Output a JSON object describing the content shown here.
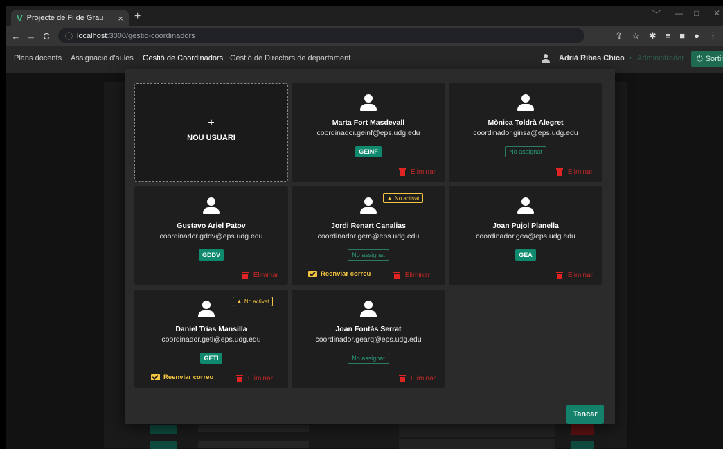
{
  "browser": {
    "tab_title": "Projecte de Fi de Grau",
    "tab_close": "×",
    "new_tab": "+",
    "url_host": "localhost",
    "url_path": ":3000/gestio-coordinadors"
  },
  "nav": {
    "links": [
      "Plans docents",
      "Assignació d'aules",
      "Gestió de Coordinadors",
      "Gestió de Directors de departament"
    ],
    "active_index": 2,
    "user_name": "Adrià Ribas Chico",
    "role": "Administrador",
    "logout_label": "Sortir"
  },
  "modal": {
    "new_user_plus": "+",
    "new_user_label": "NOU USUARI",
    "close_label": "Tancar",
    "delete_label": "Eliminar",
    "resend_label": "Reenviar correu",
    "not_activated_label": "No activat",
    "coordinators": [
      {
        "name": "Marta Fort Masdevall",
        "email": "coordinador.geinf@eps.udg.edu",
        "badge": "GEINF",
        "assigned": true,
        "activated": true
      },
      {
        "name": "Mònica Toldrà Alegret",
        "email": "coordinador.ginsa@eps.udg.edu",
        "badge": "No assignat",
        "assigned": false,
        "activated": true
      },
      {
        "name": "Gustavo Ariel Patov",
        "email": "coordinador.gddv@eps.udg.edu",
        "badge": "GDDV",
        "assigned": true,
        "activated": true
      },
      {
        "name": "Jordi Renart Canalias",
        "email": "coordinador.gem@eps.udg.edu",
        "badge": "No assignat",
        "assigned": false,
        "activated": false
      },
      {
        "name": "Joan Pujol Planella",
        "email": "coordinador.gea@eps.udg.edu",
        "badge": "GEA",
        "assigned": true,
        "activated": true
      },
      {
        "name": "Daniel Trias Mansilla",
        "email": "coordinador.geti@eps.udg.edu",
        "badge": "GETI",
        "assigned": true,
        "activated": false
      },
      {
        "name": "Joan Fontàs Serrat",
        "email": "coordinador.gearq@eps.udg.edu",
        "badge": "No assignat",
        "assigned": false,
        "activated": true
      }
    ]
  },
  "colors": {
    "accent": "#14826a",
    "danger": "#e02424",
    "warning": "#f4c542"
  }
}
